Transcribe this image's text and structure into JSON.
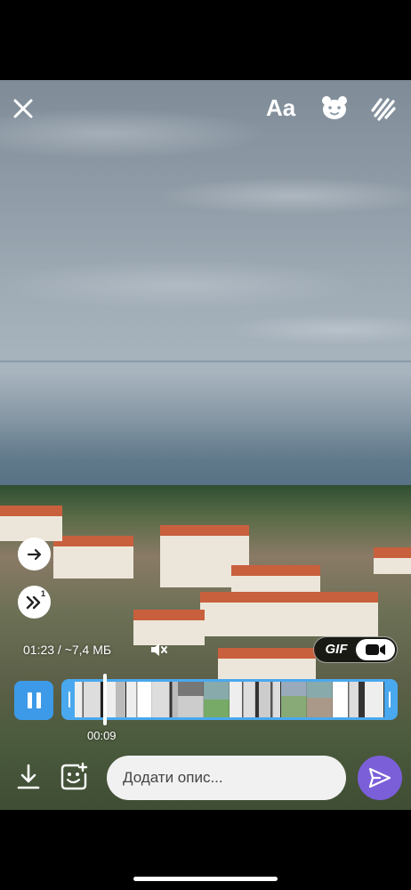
{
  "top_bar": {
    "close_icon": "close-icon",
    "text_button_label": "Aa",
    "sticker_icon": "bear-sticker-icon",
    "draw_icon": "scribble-draw-icon"
  },
  "side_controls": {
    "forward_icon": "arrow-right-icon",
    "speed_icon": "double-chevron-icon",
    "speed_superscript": "1"
  },
  "video_info": {
    "duration_size": "01:23 / ~7,4 МБ",
    "mute_icon": "speaker-mute-icon",
    "gif_label": "GIF",
    "video_icon": "video-camera-icon"
  },
  "trimmer": {
    "pause_icon": "pause-icon",
    "current_time": "00:09",
    "frame_count": 12,
    "accent_color": "#4aa8ee"
  },
  "bottom_bar": {
    "download_icon": "download-icon",
    "add_sticker_icon": "add-sticker-icon",
    "caption_placeholder": "Додати опис...",
    "send_icon": "send-icon",
    "send_color": "#7b5fd9"
  }
}
